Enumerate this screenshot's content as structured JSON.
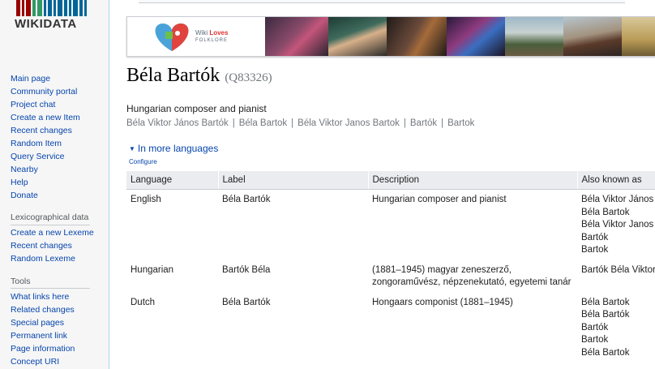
{
  "logo": {
    "text": "WIKIDATA",
    "colors": [
      "#990000",
      "#339966",
      "#006699"
    ]
  },
  "sidebar": {
    "main": [
      "Main page",
      "Community portal",
      "Project chat",
      "Create a new Item",
      "Recent changes",
      "Random Item",
      "Query Service",
      "Nearby",
      "Help",
      "Donate"
    ],
    "lexeme_heading": "Lexicographical data",
    "lexeme": [
      "Create a new Lexeme",
      "Recent changes",
      "Random Lexeme"
    ],
    "tools_heading": "Tools",
    "tools": [
      "What links here",
      "Related changes",
      "Special pages",
      "Permanent link",
      "Page information",
      "Concept URI"
    ]
  },
  "banner": {
    "line1_a": "Wiki ",
    "line1_b": "Loves",
    "line2": "FOLKLORE"
  },
  "item": {
    "label": "Béla Bartók",
    "id": "(Q83326)",
    "description": "Hungarian composer and pianist",
    "aliases": [
      "Béla Viktor János Bartók",
      "Béla Bartok",
      "Béla Viktor Janos Bartok",
      "Bartók",
      "Bartok"
    ]
  },
  "languages_toggle": "In more languages",
  "configure_link": "Configure",
  "table": {
    "headers": [
      "Language",
      "Label",
      "Description",
      "Also known as"
    ],
    "rows": [
      {
        "language": "English",
        "label": "Béla Bartók",
        "description": [
          "Hungarian composer and pianist"
        ],
        "also": [
          "Béla Viktor János",
          "Béla Bartok",
          "Béla Viktor Janos",
          "Bartók",
          "Bartok"
        ]
      },
      {
        "language": "Hungarian",
        "label": "Bartók Béla",
        "description": [
          "(1881–1945) magyar zeneszerző,",
          "zongoraművész, népzenekutató, egyetemi tanár"
        ],
        "also": [
          "Bartók Béla Viktor"
        ]
      },
      {
        "language": "Dutch",
        "label": "Béla Bartók",
        "description": [
          "Hongaars componist (1881–1945)"
        ],
        "also": [
          "Béla Bartok",
          "Béla Bartók",
          "Bartók",
          "Bartok",
          "Béla Bartok"
        ]
      }
    ]
  }
}
